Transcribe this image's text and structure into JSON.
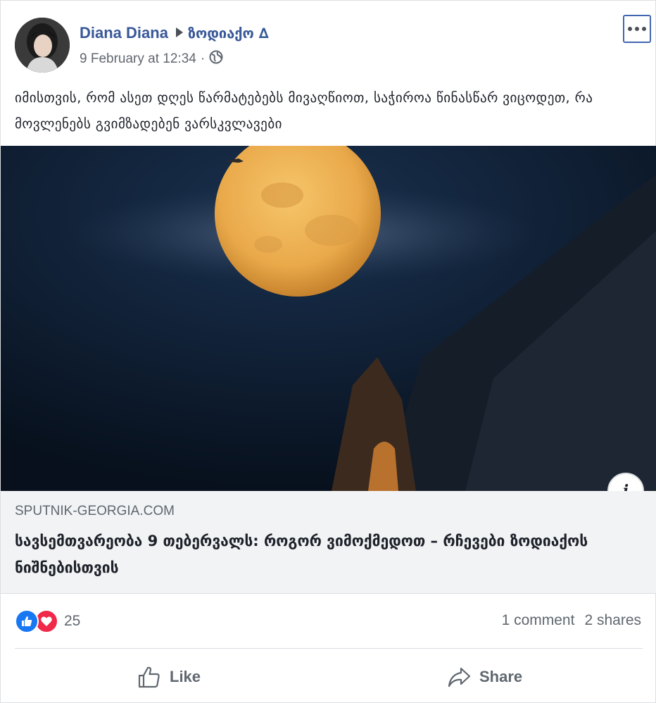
{
  "post": {
    "author": "Diana Diana",
    "group": "ზოდიაქო ∆",
    "timestamp": "9 February at 12:34",
    "privacy_icon": "globe-icon",
    "text": "იმისთვის, რომ ასეთ დღეს წარმატებებს მივაღწიოთ, საჭიროა წინასწარ ვიცოდეთ, რა მოვლენებს გვიმზადებენ ვარსკვლავები"
  },
  "link": {
    "domain": "SPUTNIK-GEORGIA.COM",
    "title": "სავსემთვარეობა 9 თებერვალს: როგორ ვიმოქმედოთ – რჩევები ზოდიაქოს ნიშნებისთვის",
    "info_label": "i"
  },
  "engagement": {
    "reactions_count": "25",
    "comments": "1 comment",
    "shares": "2 shares"
  },
  "actions": {
    "like_label": "Like",
    "share_label": "Share"
  },
  "colors": {
    "link_blue": "#385898",
    "like_blue": "#1877f2",
    "love_red": "#f0284a",
    "muted_text": "#606770",
    "preview_bg": "#f2f3f5"
  }
}
